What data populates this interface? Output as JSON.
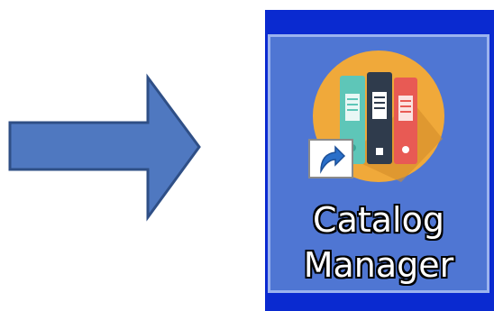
{
  "desktop_icon": {
    "label_line1": "Catalog",
    "label_line2": "Manager",
    "icon_name": "catalog-manager-binders-icon",
    "has_shortcut_overlay": true,
    "selected": true
  },
  "pointer": {
    "icon_name": "right-arrow-icon",
    "color": "#4f78c0"
  },
  "colors": {
    "desktop_blue": "#0a2ad0",
    "selection_fill": "#4f76d3",
    "icon_circle": "#f0a93a",
    "binder_teal": "#5ec6b8",
    "binder_dark": "#2f3b4c",
    "binder_red": "#e85a54"
  }
}
